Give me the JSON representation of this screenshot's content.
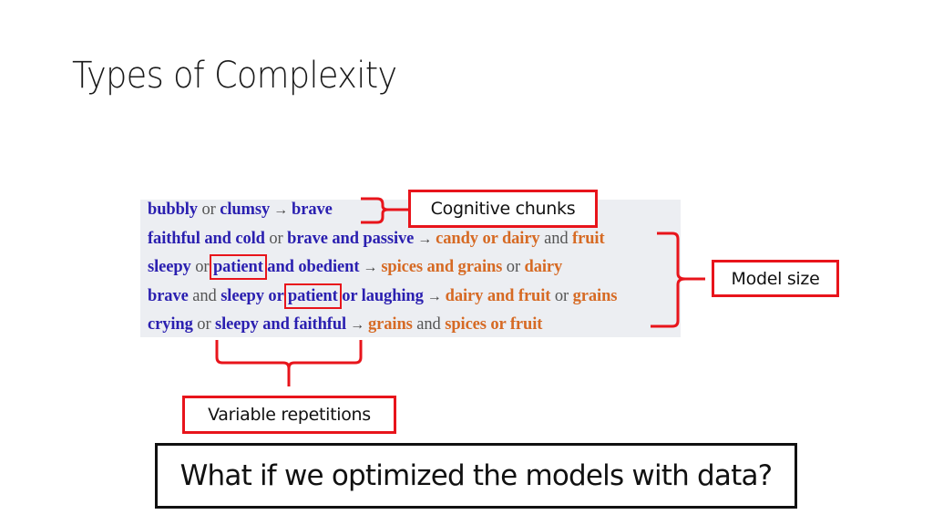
{
  "slide": {
    "title": "Types of Complexity",
    "examples": [
      {
        "segments": [
          {
            "t": "bubbly",
            "k": "b"
          },
          {
            "t": " or ",
            "k": "c"
          },
          {
            "t": "clumsy",
            "k": "b"
          },
          {
            "t": "→",
            "k": "arrow"
          },
          {
            "t": "brave",
            "k": "b"
          }
        ]
      },
      {
        "segments": [
          {
            "t": "faithful and cold",
            "k": "b"
          },
          {
            "t": " or ",
            "k": "c"
          },
          {
            "t": "brave and passive",
            "k": "b"
          },
          {
            "t": "→",
            "k": "arrow"
          },
          {
            "t": "candy or dairy",
            "k": "o"
          },
          {
            "t": " and ",
            "k": "c"
          },
          {
            "t": "fruit",
            "k": "o"
          }
        ]
      },
      {
        "segments": [
          {
            "t": "sleepy",
            "k": "b"
          },
          {
            "t": " or ",
            "k": "c"
          },
          {
            "t": "patient",
            "k": "b",
            "highlight": true
          },
          {
            "t": " and obedient",
            "k": "b"
          },
          {
            "t": "→",
            "k": "arrow"
          },
          {
            "t": "spices and grains",
            "k": "o"
          },
          {
            "t": " or ",
            "k": "c"
          },
          {
            "t": "dairy",
            "k": "o"
          }
        ]
      },
      {
        "segments": [
          {
            "t": "brave",
            "k": "b"
          },
          {
            "t": " and ",
            "k": "c"
          },
          {
            "t": "sleepy or ",
            "k": "b"
          },
          {
            "t": "patient",
            "k": "b",
            "highlight": true
          },
          {
            "t": " or laughing",
            "k": "b"
          },
          {
            "t": "→",
            "k": "arrow"
          },
          {
            "t": "dairy and fruit",
            "k": "o"
          },
          {
            "t": " or ",
            "k": "c"
          },
          {
            "t": "grains",
            "k": "o"
          }
        ]
      },
      {
        "segments": [
          {
            "t": "crying",
            "k": "b"
          },
          {
            "t": " or ",
            "k": "c"
          },
          {
            "t": "sleepy and faithful",
            "k": "b"
          },
          {
            "t": "→",
            "k": "arrow"
          },
          {
            "t": "grains",
            "k": "o"
          },
          {
            "t": " and ",
            "k": "c"
          },
          {
            "t": "spices or fruit",
            "k": "o"
          }
        ]
      }
    ],
    "annotations": {
      "cognitive_chunks": "Cognitive chunks",
      "model_size": "Model size",
      "variable_repetitions": "Variable repetitions"
    },
    "question": "What if we optimized the models with data?",
    "colors": {
      "annotation_red": "#e8141b",
      "input_blue": "#2a1fb0",
      "output_orange": "#d66a24",
      "connector_gray": "#555555",
      "panel_bg": "#eceef2"
    }
  }
}
